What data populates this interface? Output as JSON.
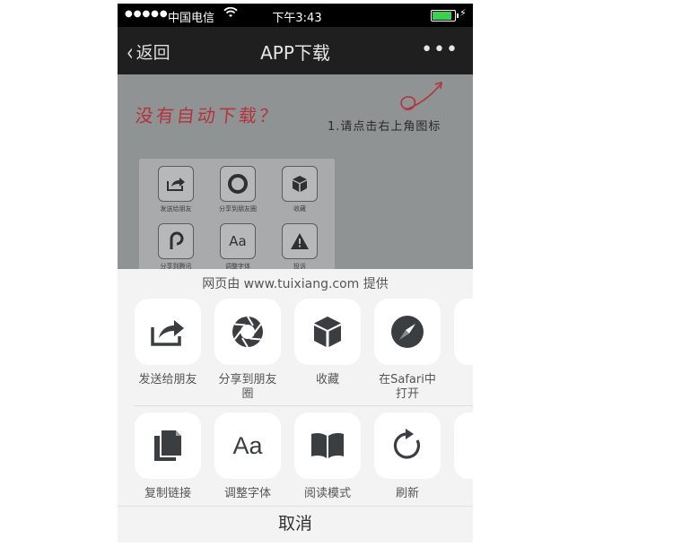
{
  "status_bar": {
    "signal": "●●●●●",
    "carrier": "中国电信",
    "time": "下午3:43"
  },
  "nav": {
    "back_label": "返回",
    "title": "APP下载",
    "more": "•••"
  },
  "page_content": {
    "headline": "没有自动下载？",
    "instruction": "1.请点击右上角图标",
    "preview_items": [
      {
        "label": "发送给朋友",
        "icon": "share-icon"
      },
      {
        "label": "分享到朋友圈",
        "icon": "aperture-icon"
      },
      {
        "label": "收藏",
        "icon": "cube-icon"
      },
      {
        "label": "分享到腾讯",
        "icon": "p-icon"
      },
      {
        "label": "调整字体",
        "icon": "font-icon"
      },
      {
        "label": "投诉",
        "icon": "warning-icon"
      }
    ]
  },
  "sheet": {
    "provided_by": "网页由 www.tuixiang.com 提供",
    "row1": [
      {
        "label": "发送给朋友",
        "icon": "share-icon"
      },
      {
        "label": "分享到朋友圈",
        "icon": "aperture-icon"
      },
      {
        "label": "收藏",
        "icon": "cube-icon"
      },
      {
        "label": "在Safari中\n打开",
        "icon": "compass-icon"
      }
    ],
    "row2": [
      {
        "label": "复制链接",
        "icon": "copy-icon"
      },
      {
        "label": "调整字体",
        "icon": "font-icon"
      },
      {
        "label": "阅读模式",
        "icon": "book-icon"
      },
      {
        "label": "刷新",
        "icon": "refresh-icon"
      }
    ],
    "cancel_label": "取消"
  },
  "colors": {
    "nav_bg": "#1f1f1f",
    "headline_red": "#b3323c",
    "icon_dark": "#3b3e40"
  }
}
